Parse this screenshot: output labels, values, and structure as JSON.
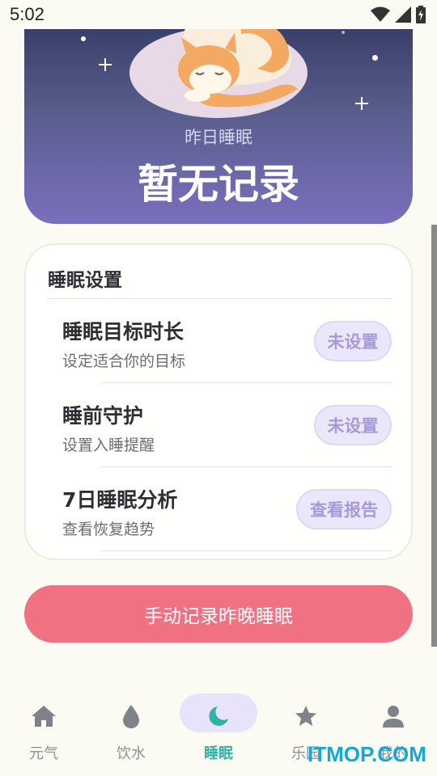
{
  "status_bar": {
    "time": "5:02",
    "icons": [
      "wifi-icon",
      "signal-icon",
      "battery-icon"
    ]
  },
  "hero": {
    "subtitle": "昨日睡眠",
    "title": "暂无记录"
  },
  "settings": {
    "title": "睡眠设置",
    "rows": [
      {
        "title": "睡眠目标时长",
        "desc": "设定适合你的目标",
        "action": "未设置"
      },
      {
        "title": "睡前守护",
        "desc": "设置入睡提醒",
        "action": "未设置"
      },
      {
        "title": "7日睡眠分析",
        "desc": "查看恢复趋势",
        "action": "查看报告"
      }
    ]
  },
  "manual_button": "手动记录昨晚睡眠",
  "nav": {
    "items": [
      {
        "label": "元气",
        "icon": "home-icon"
      },
      {
        "label": "饮水",
        "icon": "water-drop-icon"
      },
      {
        "label": "睡眠",
        "icon": "moon-icon"
      },
      {
        "label": "乐园",
        "icon": "star-icon"
      },
      {
        "label": "我的",
        "icon": "person-icon"
      }
    ],
    "active": "睡眠"
  },
  "colors": {
    "accent": "#f07282",
    "active_nav": "#2fb3a4",
    "pill_bg": "#ebe7fb",
    "hero_top": "#3a3f6a",
    "hero_bottom": "#7a6fbe"
  },
  "watermark": "ITMOP.COM"
}
